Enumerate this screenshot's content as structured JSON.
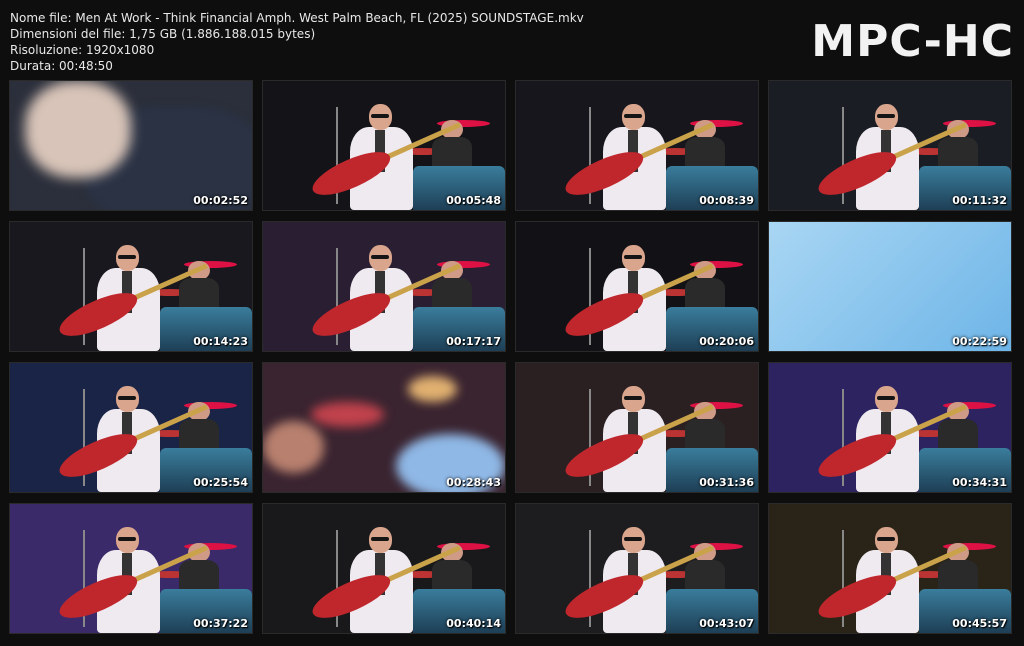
{
  "header": {
    "file_name": "Nome file: Men At Work - Think Financial Amph. West Palm Beach, FL (2025) SOUNDSTAGE.mkv",
    "file_size": "Dimensioni del file: 1,75 GB (1.886.188.015 bytes)",
    "resolution": "Risoluzione: 1920x1080",
    "duration": "Durata: 00:48:50"
  },
  "logo": "MPC-HC",
  "colors": {
    "background": "#0e0e0e",
    "text": "#e8e8e8",
    "logo": "#f2f2f2"
  },
  "thumbnails": [
    {
      "time": "00:02:52",
      "scene": "blur-face",
      "tint": "#2b2f3b"
    },
    {
      "time": "00:05:48",
      "scene": "band",
      "tint": "#141418"
    },
    {
      "time": "00:08:39",
      "scene": "band",
      "tint": "#16161c"
    },
    {
      "time": "00:11:32",
      "scene": "band",
      "tint": "#1b1d24"
    },
    {
      "time": "00:14:23",
      "scene": "band",
      "tint": "#18181e"
    },
    {
      "time": "00:17:17",
      "scene": "band",
      "tint": "#2a1e33"
    },
    {
      "time": "00:20:06",
      "scene": "band",
      "tint": "#121216"
    },
    {
      "time": "00:22:59",
      "scene": "sky",
      "tint": "#8fc8ef"
    },
    {
      "time": "00:25:54",
      "scene": "band",
      "tint": "#1a2446"
    },
    {
      "time": "00:28:43",
      "scene": "blur-crowd",
      "tint": "#3a2430"
    },
    {
      "time": "00:31:36",
      "scene": "band",
      "tint": "#2a2022"
    },
    {
      "time": "00:34:31",
      "scene": "band",
      "tint": "#2d2360"
    },
    {
      "time": "00:37:22",
      "scene": "band",
      "tint": "#3a2a6a"
    },
    {
      "time": "00:40:14",
      "scene": "band",
      "tint": "#19191c"
    },
    {
      "time": "00:43:07",
      "scene": "band",
      "tint": "#1d1d20"
    },
    {
      "time": "00:45:57",
      "scene": "band",
      "tint": "#2a2418"
    }
  ]
}
